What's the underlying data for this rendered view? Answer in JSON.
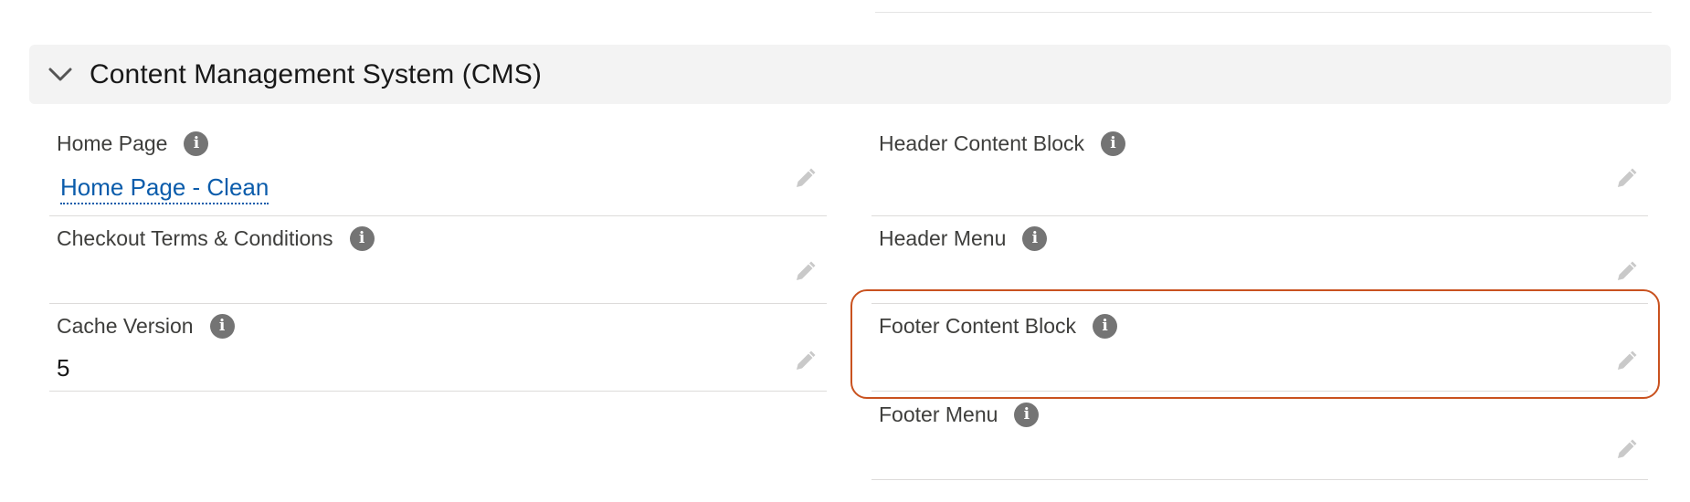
{
  "section": {
    "title": "Content Management System (CMS)",
    "expanded": true
  },
  "fields": {
    "home_page": {
      "label": "Home Page",
      "value": "Home Page - Clean",
      "is_link": true
    },
    "header_content_block": {
      "label": "Header Content Block",
      "value": ""
    },
    "checkout_terms": {
      "label": "Checkout Terms & Conditions",
      "value": ""
    },
    "header_menu": {
      "label": "Header Menu",
      "value": ""
    },
    "cache_version": {
      "label": "Cache Version",
      "value": "5"
    },
    "footer_content_block": {
      "label": "Footer Content Block",
      "value": "",
      "highlighted": true
    },
    "footer_menu": {
      "label": "Footer Menu",
      "value": ""
    }
  },
  "icons": {
    "info": "info-icon",
    "edit": "pencil-icon",
    "chevron": "chevron-down-icon"
  },
  "colors": {
    "link": "#0b5cab",
    "highlight": "#c9521f",
    "header_bg": "#f3f3f3",
    "info_icon_bg": "#747474",
    "edit_icon": "#c9c9c9"
  }
}
